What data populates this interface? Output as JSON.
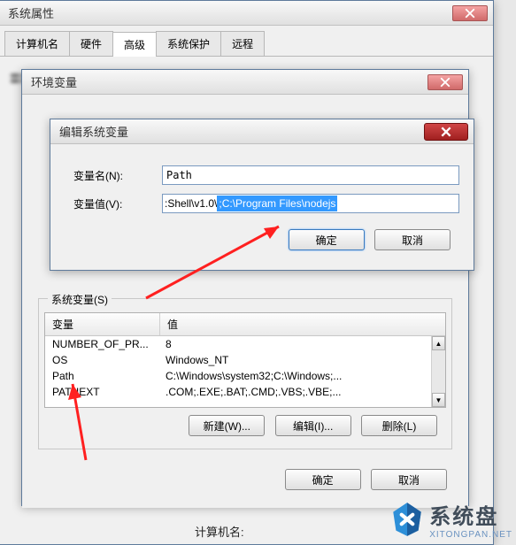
{
  "sysprops": {
    "title": "系统属性",
    "tabs": [
      "计算机名",
      "硬件",
      "高级",
      "系统保护",
      "远程"
    ],
    "bottom_label": "计算机名:"
  },
  "envvars": {
    "title": "环境变量",
    "sysvars_legend": "系统变量(S)",
    "col_var": "变量",
    "col_val": "值",
    "rows": [
      {
        "name": "NUMBER_OF_PR...",
        "value": "8"
      },
      {
        "name": "OS",
        "value": "Windows_NT"
      },
      {
        "name": "Path",
        "value": "C:\\Windows\\system32;C:\\Windows;..."
      },
      {
        "name": "PATHEXT",
        "value": ".COM;.EXE;.BAT;.CMD;.VBS;.VBE;..."
      }
    ],
    "btn_new": "新建(W)...",
    "btn_edit": "编辑(I)...",
    "btn_del": "删除(L)",
    "btn_ok": "确定",
    "btn_cancel": "取消"
  },
  "editvar": {
    "title": "编辑系统变量",
    "label_name": "变量名(N):",
    "label_value": "变量值(V):",
    "name_value": "Path",
    "value_prefix": ":Shell\\v1.0\\",
    "value_highlight": ";C:\\Program Files\\nodejs",
    "btn_ok": "确定",
    "btn_cancel": "取消"
  },
  "watermark": {
    "text": "系统盘",
    "sub": "XITONGPAN.NET"
  }
}
